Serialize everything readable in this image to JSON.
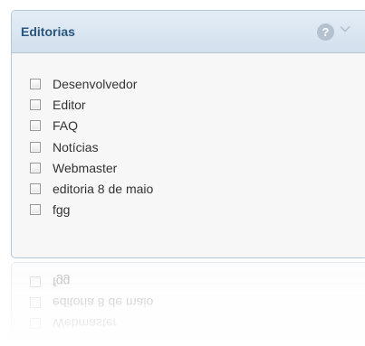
{
  "panel": {
    "title": "Editorias",
    "help_icon": "help-icon",
    "help_glyph": "?",
    "collapse_icon": "chevron-down-icon"
  },
  "items": [
    {
      "label": "Desenvolvedor",
      "checked": false
    },
    {
      "label": "Editor",
      "checked": false
    },
    {
      "label": "FAQ",
      "checked": false
    },
    {
      "label": "Notícias",
      "checked": false
    },
    {
      "label": "Webmaster",
      "checked": false
    },
    {
      "label": "editoria 8 de maio",
      "checked": false
    },
    {
      "label": "fgg",
      "checked": false
    }
  ],
  "colors": {
    "header_text": "#29557f",
    "border": "#b7c7d6",
    "header_bg": "#dbe7f2"
  }
}
